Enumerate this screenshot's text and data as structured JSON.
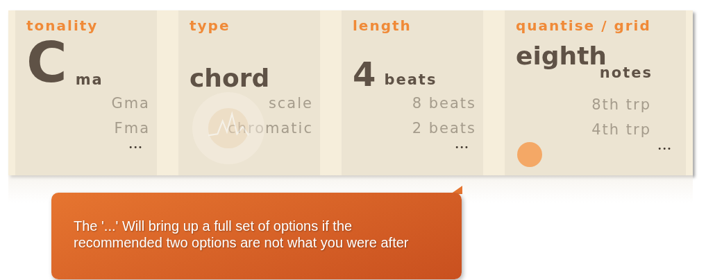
{
  "columns": [
    {
      "kind": "inline",
      "label": "tonality",
      "value": "C",
      "suffix": "ma",
      "options": [
        "Gma",
        "Fma"
      ],
      "more": "•••"
    },
    {
      "kind": "inline",
      "label": "type",
      "value": "chord",
      "options": [
        "scale",
        "chromatic"
      ]
    },
    {
      "kind": "inline",
      "label": "length",
      "value": "4",
      "suffix": "beats",
      "options": [
        "8 beats",
        "2 beats"
      ],
      "more": "•••"
    },
    {
      "kind": "stacked",
      "label": "quantise / grid",
      "value": "eighth",
      "suffix": "notes",
      "options": [
        "8th trp",
        "4th trp"
      ],
      "more": "•••"
    }
  ],
  "callout": {
    "text": "The '...' Will bring up a full set of options if the recommended two options are not what you were after"
  }
}
